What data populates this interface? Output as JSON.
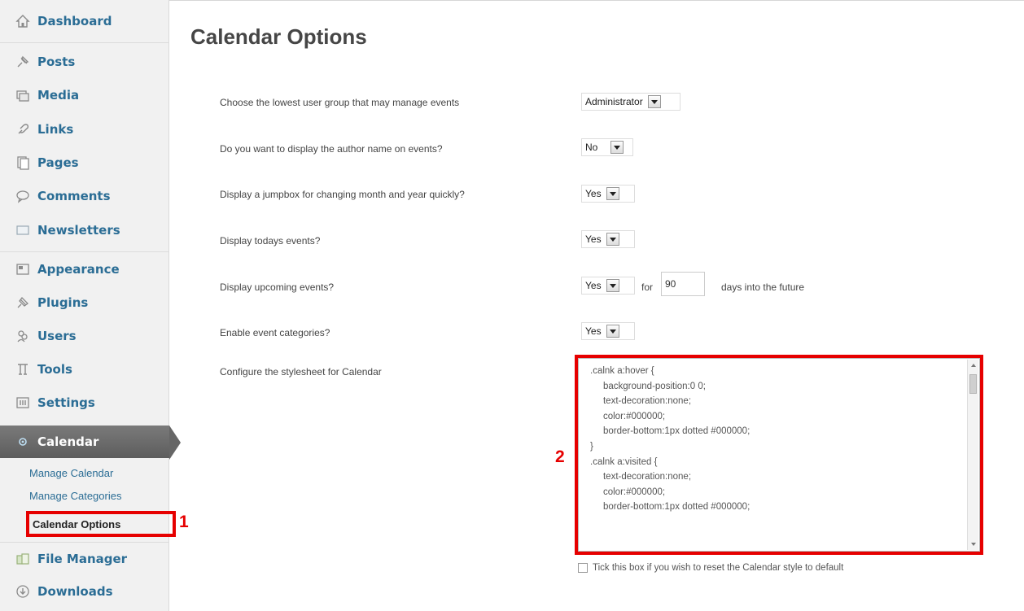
{
  "sidebar": {
    "items": [
      {
        "label": "Dashboard",
        "icon": "house-icon"
      },
      {
        "label": "Posts",
        "icon": "pin-icon"
      },
      {
        "label": "Media",
        "icon": "media-icon"
      },
      {
        "label": "Links",
        "icon": "link-icon"
      },
      {
        "label": "Pages",
        "icon": "pages-icon"
      },
      {
        "label": "Comments",
        "icon": "comment-icon"
      },
      {
        "label": "Newsletters",
        "icon": "newsletter-icon"
      },
      {
        "label": "Appearance",
        "icon": "appearance-icon"
      },
      {
        "label": "Plugins",
        "icon": "plugin-icon"
      },
      {
        "label": "Users",
        "icon": "users-icon"
      },
      {
        "label": "Tools",
        "icon": "tools-icon"
      },
      {
        "label": "Settings",
        "icon": "settings-icon"
      },
      {
        "label": "Calendar",
        "icon": "gear-icon"
      },
      {
        "label": "File Manager",
        "icon": "file-manager-icon"
      },
      {
        "label": "Downloads",
        "icon": "downloads-icon"
      }
    ],
    "calendar_submenu": [
      "Manage Calendar",
      "Manage Categories",
      "Calendar Options"
    ]
  },
  "annotations": {
    "one": "1",
    "two": "2"
  },
  "page": {
    "title": "Calendar Options"
  },
  "options": {
    "manage_group": {
      "label": "Choose the lowest user group that may manage events",
      "value": "Administrator"
    },
    "display_author": {
      "label": "Do you want to display the author name on events?",
      "value": "No"
    },
    "jumpbox": {
      "label": "Display a jumpbox for changing month and year quickly?",
      "value": "Yes"
    },
    "todays_events": {
      "label": "Display todays events?",
      "value": "Yes"
    },
    "upcoming_events": {
      "label": "Display upcoming events?",
      "value": "Yes",
      "for_text": "for",
      "days_value": "90",
      "suffix": "days into the future"
    },
    "categories": {
      "label": "Enable event categories?",
      "value": "Yes"
    },
    "stylesheet": {
      "label": "Configure the stylesheet for Calendar",
      "css": ".calnk a:hover {\n     background-position:0 0;\n     text-decoration:none;\n     color:#000000;\n     border-bottom:1px dotted #000000;\n}\n.calnk a:visited {\n     text-decoration:none;\n     color:#000000;\n     border-bottom:1px dotted #000000;",
      "reset_label": "Tick this box if you wish to reset the Calendar style to default"
    }
  },
  "colors": {
    "link": "#2b6d95",
    "highlight": "#e60000",
    "active_menu": "#666666"
  }
}
